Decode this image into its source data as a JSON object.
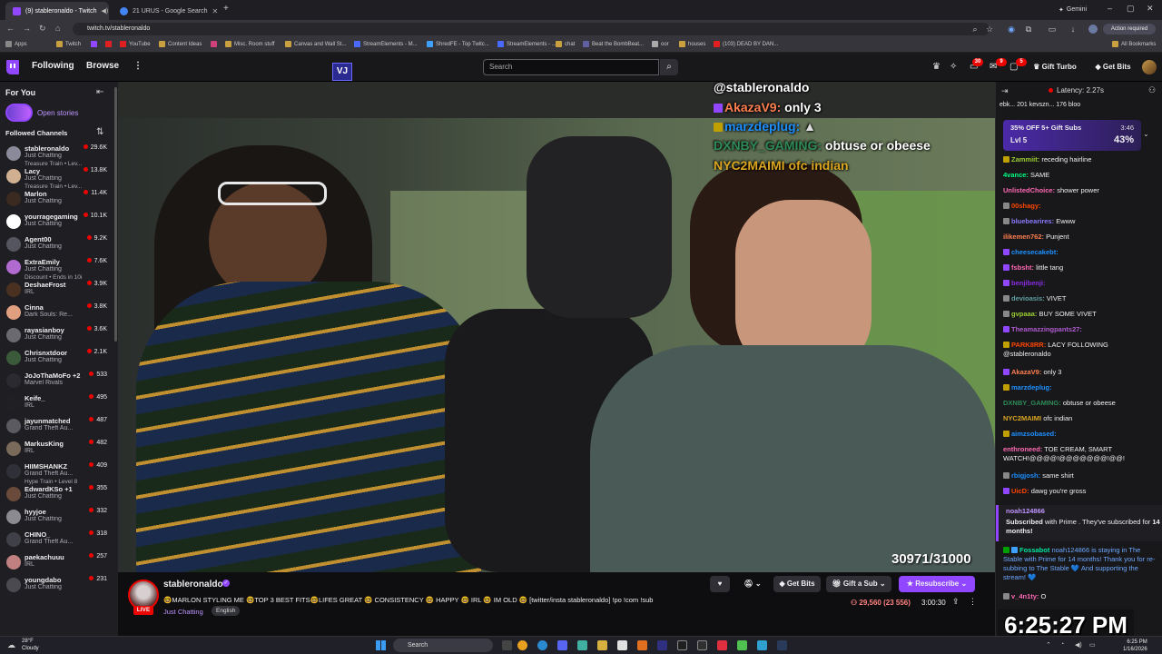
{
  "browser": {
    "tabs": [
      {
        "label": "(9) stableronaldo - Twitch",
        "active": true
      },
      {
        "label": "21 URUS - Google Search",
        "active": false
      }
    ],
    "gemini_label": "Gemini",
    "url": "twitch.tv/stableronaldo",
    "action_required": "Action required",
    "bookmarks": [
      "Apps",
      "Twitch",
      "YouTube",
      "Content Ideas",
      "Misc. Room stuff",
      "Canvas and Wall St...",
      "StreamElements - M...",
      "ShredFE - Top Twitc...",
      "StreamElements - ...",
      "chat",
      "Beat the BombBeat...",
      "oor",
      "houses",
      "(103) DEAD BY DAN..."
    ],
    "all_bookmarks": "All Bookmarks"
  },
  "twitch_nav": {
    "following": "Following",
    "browse": "Browse",
    "search_placeholder": "Search",
    "notif_counts": [
      "30",
      "9",
      "5"
    ],
    "gift_turbo": "Gift Turbo",
    "get_bits": "Get Bits"
  },
  "sidebar": {
    "for_you": "For You",
    "open_stories": "Open stories",
    "followed_channels": "Followed Channels",
    "channels": [
      {
        "name": "stableronaldo",
        "category": "Just Chatting",
        "extra": "Treasure Train • Lev...",
        "viewers": "29.6K",
        "color": "#8a8a9a"
      },
      {
        "name": "Lacy",
        "category": "Just Chatting",
        "extra": "Treasure Train • Lev...",
        "viewers": "13.8K",
        "color": "#d0b090"
      },
      {
        "name": "Marlon",
        "category": "Just Chatting",
        "extra": "",
        "viewers": "11.4K",
        "color": "#3a2a20"
      },
      {
        "name": "yourragegaming",
        "category": "Just Chatting",
        "extra": "",
        "viewers": "10.1K",
        "color": "#ffffff"
      },
      {
        "name": "Agent00",
        "category": "Just Chatting",
        "extra": "",
        "viewers": "9.2K",
        "color": "#555560"
      },
      {
        "name": "ExtraEmily",
        "category": "Just Chatting",
        "extra": "Discount • Ends in 10i",
        "viewers": "7.6K",
        "color": "#b06ad0"
      },
      {
        "name": "DeshaeFrost",
        "category": "IRL",
        "extra": "",
        "viewers": "3.9K",
        "color": "#4a3020"
      },
      {
        "name": "Cinna",
        "category": "Dark Souls: Re...",
        "extra": "",
        "viewers": "3.8K",
        "color": "#e0a080"
      },
      {
        "name": "rayasianboy",
        "category": "Just Chatting",
        "extra": "",
        "viewers": "3.6K",
        "color": "#6a6a70"
      },
      {
        "name": "Chrisnxtdoor",
        "category": "Just Chatting",
        "extra": "",
        "viewers": "2.1K",
        "color": "#3a5a3a"
      },
      {
        "name": "JoJoThaMoFo +2",
        "category": "Marvel Rivals",
        "extra": "",
        "viewers": "533",
        "color": "#2a2a30"
      },
      {
        "name": "Keife_",
        "category": "IRL",
        "extra": "",
        "viewers": "495",
        "color": "#202024"
      },
      {
        "name": "jayunmatched",
        "category": "Grand Theft Au...",
        "extra": "",
        "viewers": "487",
        "color": "#5a5a60"
      },
      {
        "name": "MarkusKing",
        "category": "IRL",
        "extra": "",
        "viewers": "482",
        "color": "#7a6a5a"
      },
      {
        "name": "HIIMSHANKZ",
        "category": "Grand Theft Au...",
        "extra": "Hype Train • Level 8",
        "viewers": "409",
        "color": "#303038"
      },
      {
        "name": "EdwardKSo +1",
        "category": "Just Chatting",
        "extra": "",
        "viewers": "355",
        "color": "#6a4a3a"
      },
      {
        "name": "hyyjoe",
        "category": "Just Chatting",
        "extra": "",
        "viewers": "332",
        "color": "#8a8a90"
      },
      {
        "name": "CHINO_",
        "category": "Grand Theft Au...",
        "extra": "",
        "viewers": "318",
        "color": "#404048"
      },
      {
        "name": "paekachuuu",
        "category": "IRL",
        "extra": "",
        "viewers": "257",
        "color": "#c08080"
      },
      {
        "name": "youngdabo",
        "category": "Just Chatting",
        "extra": "",
        "viewers": "231",
        "color": "#4a4a50"
      }
    ]
  },
  "video_overlay": {
    "lines": [
      {
        "user": "@stableronaldo",
        "text": "",
        "color": "#ffffff"
      },
      {
        "user": "AkazaV9:",
        "text": "only 3",
        "color": "#ff7f50"
      },
      {
        "user": "marzdeplug:",
        "text": "",
        "color": "#1e90ff"
      },
      {
        "user": "DXNBY_GAMING:",
        "text": "obtuse or obeese",
        "color": "#2e8b57"
      },
      {
        "user": "NYC2MAIMI",
        "text": "ofc indian",
        "color": "#daa520"
      }
    ],
    "sub_count": "30971/31000"
  },
  "stream": {
    "streamer": "stableronaldo",
    "live": "LIVE",
    "title": "🤓MARLON STYLING ME 🤓TOP 3 BEST FITS🤓LIFES GREAT 🤓 CONSISTENCY 🤓 HAPPY 🤓 IRL 🤓 IM OLD 🤓 [twitter/insta stableronaldo] !po !com !sub",
    "category": "Just Chatting",
    "language": "English",
    "get_bits": "Get Bits",
    "gift_a_sub": "Gift a Sub",
    "resubscribe": "Resubscribe",
    "viewers": "29,560 (23 556)",
    "uptime": "3:00:30"
  },
  "chat": {
    "latency": "Latency: 2.27s",
    "leaderboard": "ebk... 201  kevszn... 176  bloo",
    "gift_banner": {
      "title": "35% OFF 5+ Gift Subs",
      "level": "Lvl 5",
      "time": "3:46",
      "percent": "43%"
    },
    "messages": [
      {
        "user": "Zammiit:",
        "text": "receding hairline",
        "color": "#9acd32",
        "badge": "#c0a000"
      },
      {
        "user": "4vance:",
        "text": "SAME",
        "color": "#00ff7f",
        "badge": ""
      },
      {
        "user": "UnlistedChoice:",
        "text": "shower power",
        "color": "#ff69b4",
        "badge": ""
      },
      {
        "user": "00shagy:",
        "text": "",
        "color": "#ff4500",
        "badge": "#888888"
      },
      {
        "user": "bluebearires:",
        "text": "Ewww",
        "color": "#8a7aff",
        "badge": "#888888"
      },
      {
        "user": "ilikemen762:",
        "text": "Punjent",
        "color": "#ff7f50",
        "badge": ""
      },
      {
        "user": "cheesecakebt:",
        "text": "",
        "color": "#1e90ff",
        "badge": "#9147ff"
      },
      {
        "user": "fsbsht:",
        "text": "little tang",
        "color": "#ff69b4",
        "badge": "#9147ff"
      },
      {
        "user": "benjibenji:",
        "text": "",
        "color": "#8a2be2",
        "badge": "#9147ff"
      },
      {
        "user": "devioasis:",
        "text": "VIVET",
        "color": "#5f9ea0",
        "badge": "#888888"
      },
      {
        "user": "gvpaaa:",
        "text": "BUY SOME VIVET",
        "color": "#9acd32",
        "badge": "#888888"
      },
      {
        "user": "Theamazzingpants27:",
        "text": "",
        "color": "#b05ad0",
        "badge": "#9147ff"
      },
      {
        "user": "PARK8RR:",
        "text": "LACY FOLLOWING @stableronaldo",
        "color": "#ff4500",
        "badge": "#c0a000"
      },
      {
        "user": "AkazaV9:",
        "text": "only 3",
        "color": "#ff7f50",
        "badge": "#9147ff"
      },
      {
        "user": "marzdeplug:",
        "text": "",
        "color": "#1e90ff",
        "badge": "#c0a000"
      },
      {
        "user": "DXNBY_GAMING:",
        "text": "obtuse or obeese",
        "color": "#2e8b57",
        "badge": ""
      },
      {
        "user": "NYC2MAIMI",
        "text": "ofc indian",
        "color": "#daa520",
        "badge": ""
      },
      {
        "user": "aimzsobased:",
        "text": "",
        "color": "#1e90ff",
        "badge": "#c0a000"
      },
      {
        "user": "enthroneed:",
        "text": "TOE CREAM, SMART WATCH!@@@@!@@@@@@@!@@!",
        "color": "#ff69b4",
        "badge": ""
      },
      {
        "user": "rbigjosh:",
        "text": "same shirt",
        "color": "#1e90ff",
        "badge": "#888888"
      },
      {
        "user": "UicD:",
        "text": "dawg you're gross",
        "color": "#ff4500",
        "badge": "#9147ff"
      }
    ],
    "sub_notice": {
      "user": "noah124866",
      "text_prefix": "Subscribed",
      "text_mid": "with Prime . They've subscribed for",
      "months": "14 months!"
    },
    "fossabot": {
      "user": "Fossabot",
      "text": "noah124866 is staying in The Stable with Prime for 14 months! Thank you for re-subbing to The Stable 💙 And supporting the stream! 💙"
    },
    "last_msg": {
      "user": "v_4n1ty:",
      "text": "O"
    }
  },
  "clock_overlay": "6:25:27 PM",
  "taskbar": {
    "temp": "28°F",
    "weather": "Cloudy",
    "search": "Search",
    "time": "6:25 PM",
    "date": "1/16/2026"
  }
}
